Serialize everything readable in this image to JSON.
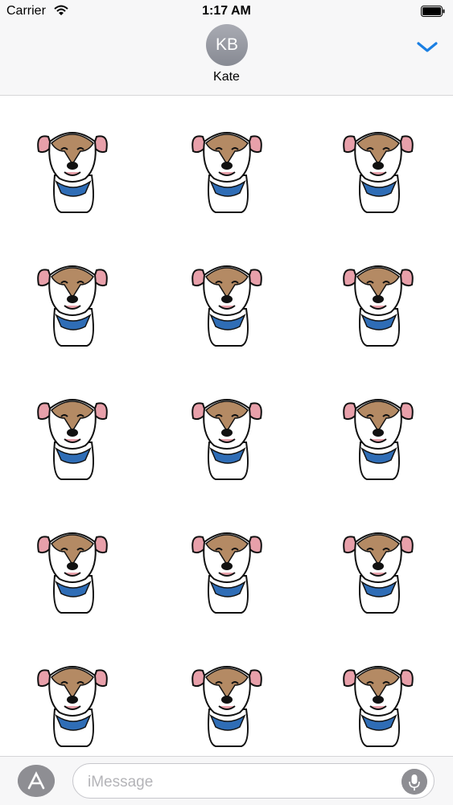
{
  "status_bar": {
    "carrier": "Carrier",
    "time": "1:17 AM",
    "wifi_icon": "wifi-icon",
    "battery_icon": "battery-icon"
  },
  "header": {
    "avatar_initials": "KB",
    "contact_name": "Kate",
    "collapse_icon": "chevron-down-icon",
    "accent_color": "#1a7fe3"
  },
  "stickers": [
    {
      "label": "dog-sticker-barking"
    },
    {
      "label": "dog-sticker-sleeping"
    },
    {
      "label": "dog-sticker-happy"
    },
    {
      "label": "dog-sticker-staring"
    },
    {
      "label": "dog-sticker-howling"
    },
    {
      "label": "dog-sticker-begging"
    },
    {
      "label": "dog-sticker-scratching"
    },
    {
      "label": "dog-sticker-dumbbell"
    },
    {
      "label": "dog-sticker-standing"
    },
    {
      "label": "dog-sticker-running"
    },
    {
      "label": "dog-sticker-tongue-out"
    },
    {
      "label": "dog-sticker-lying-tongue"
    },
    {
      "label": "dog-sticker-stretching"
    },
    {
      "label": "dog-sticker-grinning"
    },
    {
      "label": "dog-sticker-calm"
    }
  ],
  "bottom_bar": {
    "input_placeholder": "iMessage",
    "app_icon": "app-store-icon",
    "mic_icon": "microphone-icon"
  },
  "colors": {
    "fur_brown": "#b48a64",
    "bandana_blue": "#2f6db6",
    "ear_pink": "#e8a0aa"
  }
}
